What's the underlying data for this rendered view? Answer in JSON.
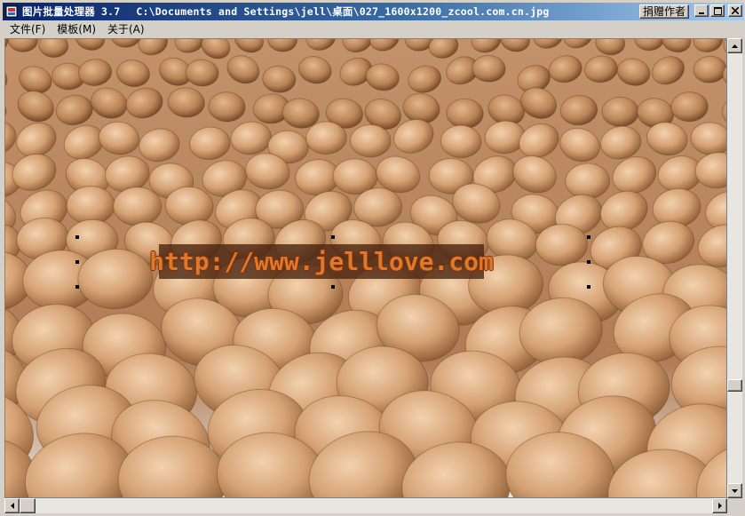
{
  "window": {
    "app_title": "图片批量处理器 3.7",
    "file_path": "C:\\Documents and Settings\\jell\\桌面\\027_1600x1200_zcool.com.cn.jpg",
    "donate_label": "捐赠作者"
  },
  "menu": {
    "items": [
      {
        "label": "文件(F)"
      },
      {
        "label": "模板(M)"
      },
      {
        "label": "关于(A)"
      }
    ]
  },
  "watermark": {
    "text": "http://www.jelllove.com",
    "color": "#e0782a"
  },
  "icons": {
    "app": "app-icon",
    "minimize": "minimize-icon",
    "maximize": "maximize-icon",
    "close": "close-icon"
  },
  "scroll": {
    "vertical_position": 0.78,
    "horizontal_position": 0.0
  }
}
